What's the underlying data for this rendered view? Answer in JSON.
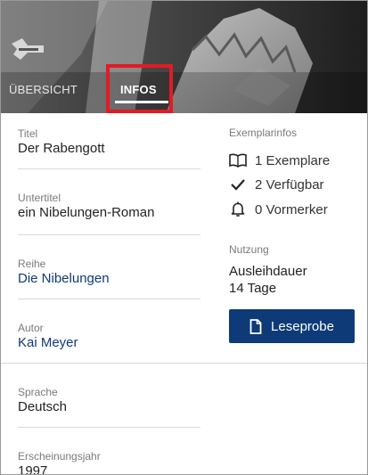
{
  "tabs": [
    {
      "label": "ÜBERSICHT"
    },
    {
      "label": "INFOS"
    }
  ],
  "details": {
    "titel": {
      "label": "Titel",
      "value": "Der Rabengott"
    },
    "untertitel": {
      "label": "Untertitel",
      "value": "ein Nibelungen-Roman"
    },
    "reihe": {
      "label": "Reihe",
      "value": "Die Nibelungen"
    },
    "autor": {
      "label": "Autor",
      "value": "Kai Meyer"
    },
    "sprache": {
      "label": "Sprache",
      "value": "Deutsch"
    },
    "jahr": {
      "label": "Erscheinungsjahr",
      "value": "1997"
    }
  },
  "exemplarinfos": {
    "heading": "Exemplarinfos",
    "exemplare": "1 Exemplare",
    "verfuegbar": "2 Verfügbar",
    "vormerker": "0 Vormerker"
  },
  "nutzung": {
    "heading": "Nutzung",
    "line1": "Ausleihdauer",
    "line2": "14 Tage"
  },
  "leseprobe_button": "Leseprobe",
  "colors": {
    "accent": "#0e3a78",
    "highlight": "#e21b24"
  }
}
